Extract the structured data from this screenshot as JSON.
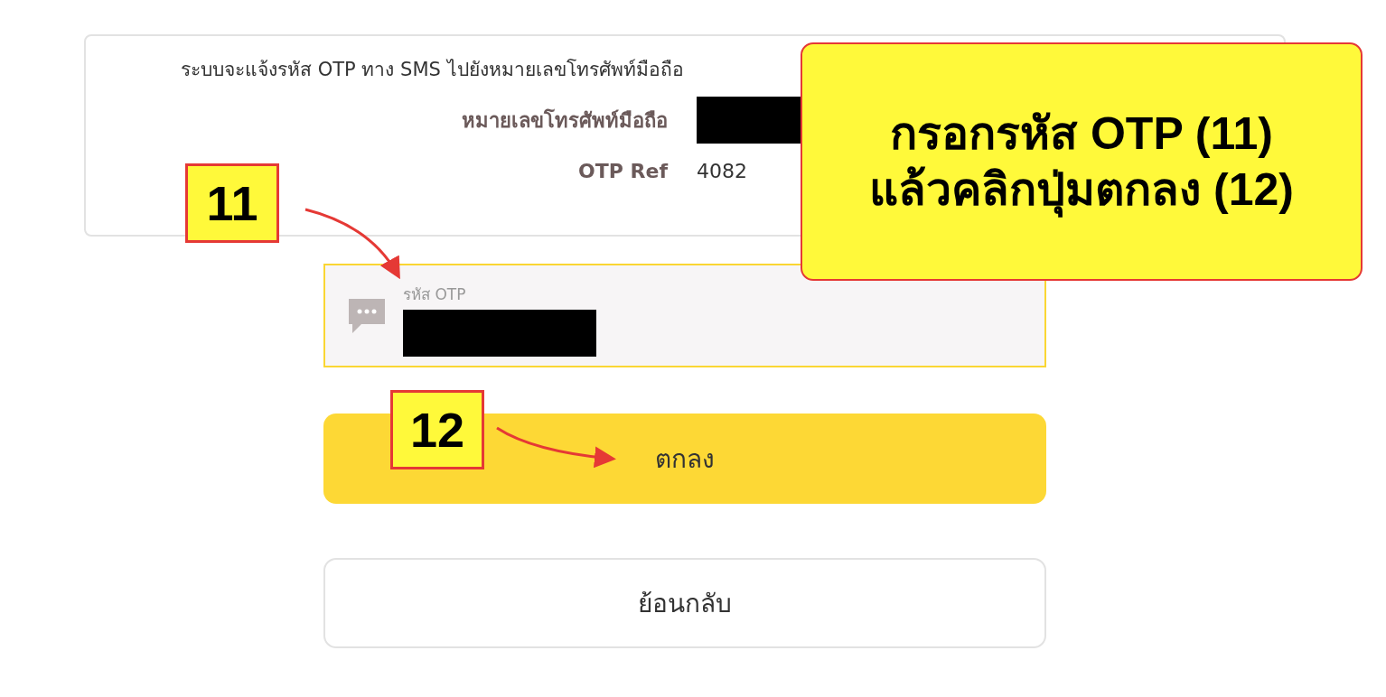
{
  "info_card": {
    "message": "ระบบจะแจ้งรหัส OTP ทาง SMS ไปยังหมายเลขโทรศัพท์มือถือ",
    "rows": [
      {
        "label": "หมายเลขโทรศัพท์มือถือ",
        "kind": "redacted"
      },
      {
        "label": "OTP Ref",
        "kind": "text",
        "value": "4082"
      }
    ]
  },
  "otp_field": {
    "label": "รหัส OTP",
    "redacted": true
  },
  "confirm_button": "ตกลง",
  "back_button": "ย้อนกลับ",
  "annotations": {
    "callout": [
      "กรอกรหัส OTP (11)",
      "แล้วคลิกปุ่มตกลง (12)"
    ],
    "markers": [
      "11",
      "12"
    ]
  }
}
